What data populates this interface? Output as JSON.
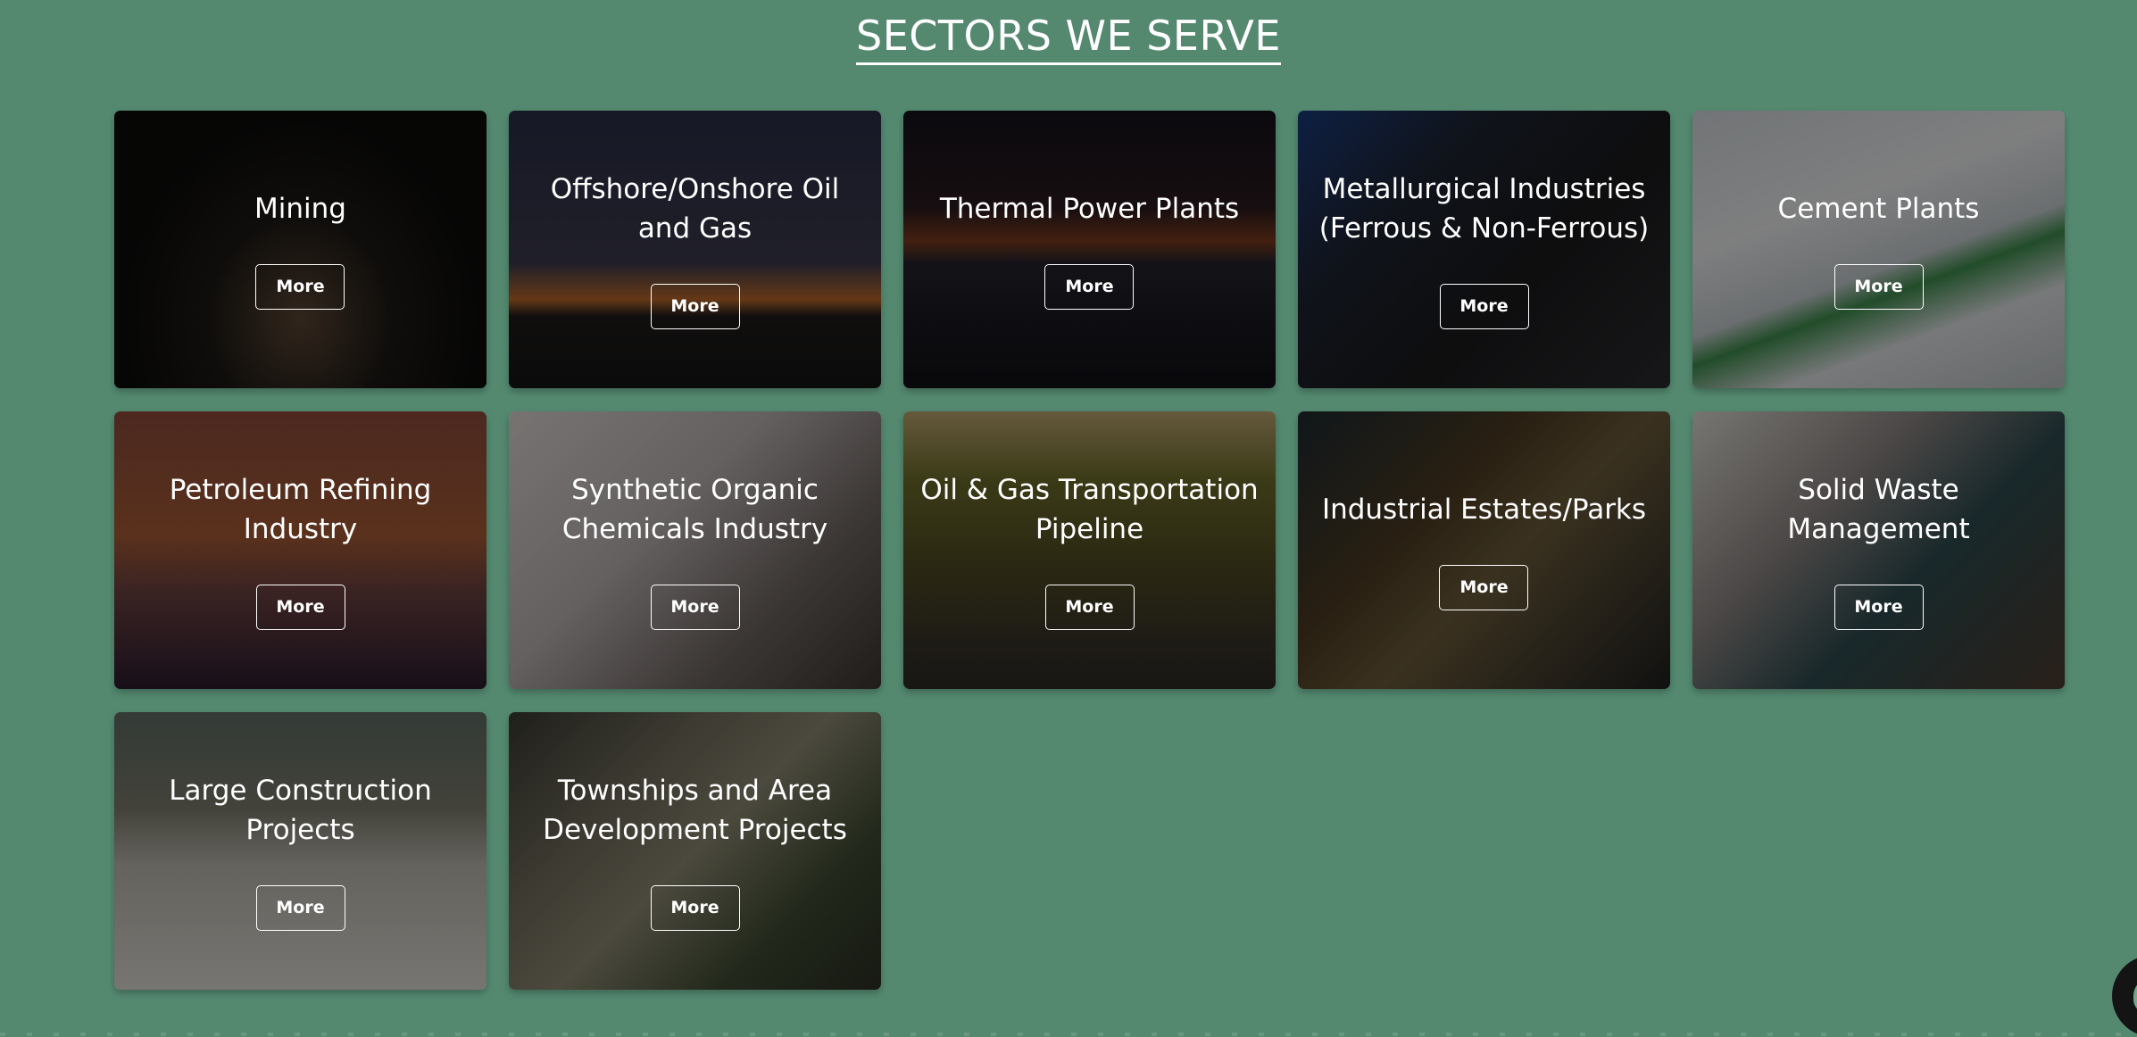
{
  "section": {
    "title": "SECTORS WE SERVE"
  },
  "colors": {
    "background": "#548970",
    "text": "#ffffff",
    "card_overlay": "rgba(0,0,0,0.45)"
  },
  "sectors": [
    {
      "title": "Mining",
      "button": "More",
      "image": "underground-mining-tunnel"
    },
    {
      "title": "Offshore/Onshore Oil and Gas",
      "button": "More",
      "image": "oil-pumpjack-sunset"
    },
    {
      "title": "Thermal Power Plants",
      "button": "More",
      "image": "power-plant-night"
    },
    {
      "title": "Metallurgical Industries (Ferrous & Non-Ferrous)",
      "button": "More",
      "image": "welder-sparks"
    },
    {
      "title": "Cement Plants",
      "button": "More",
      "image": "cement-mixer-truck"
    },
    {
      "title": "Petroleum Refining Industry",
      "button": "More",
      "image": "refinery-silhouette"
    },
    {
      "title": "Synthetic Organic Chemicals Industry",
      "button": "More",
      "image": "chemist-lab"
    },
    {
      "title": "Oil & Gas Transportation Pipeline",
      "button": "More",
      "image": "pipeline-forest"
    },
    {
      "title": "Industrial Estates/Parks",
      "button": "More",
      "image": "industrial-factory-interior"
    },
    {
      "title": "Solid Waste Management",
      "button": "More",
      "image": "waste-bins-street"
    },
    {
      "title": "Large Construction Projects",
      "button": "More",
      "image": "construction-site-workers"
    },
    {
      "title": "Townships and Area Development Projects",
      "button": "More",
      "image": "aerial-houses"
    }
  ],
  "chat_widget": {
    "icon": "chat-bubble-icon"
  }
}
